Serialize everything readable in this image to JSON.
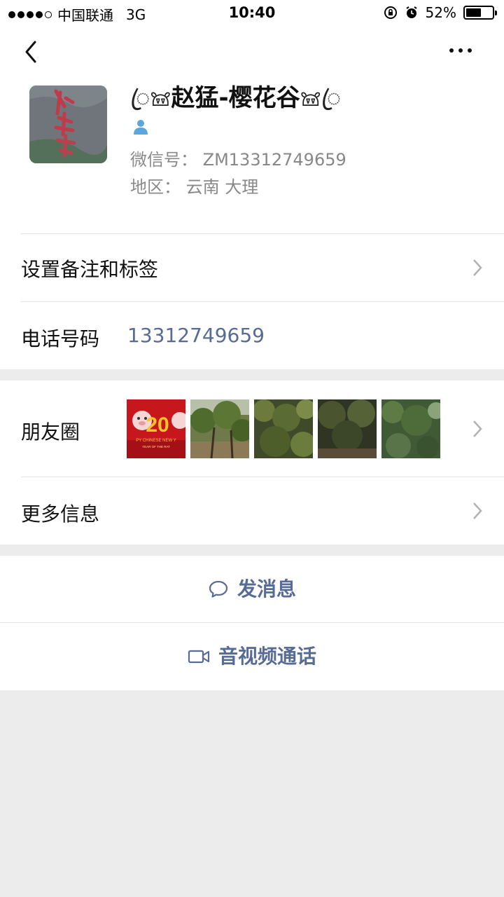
{
  "status_bar": {
    "carrier": "中国联通",
    "network": "3G",
    "time": "10:40",
    "battery": "52%"
  },
  "profile": {
    "nickname_deco_left": "ꦿ𖠌",
    "nickname": "赵猛-樱花谷",
    "nickname_deco_right": "𖠌ꦿ",
    "wechat_id_label": "微信号：",
    "wechat_id": "ZM13312749659",
    "region_label": "地区：",
    "region": "云南 大理"
  },
  "rows": {
    "remark": "设置备注和标签",
    "phone_label": "电话号码",
    "phone_value": "13312749659",
    "moments": "朋友圈",
    "more_info": "更多信息"
  },
  "moments_banner": {
    "top_text": "20",
    "mid_text": "PY CHINESE NEW Y",
    "bottom_text": "YEAR OF THE RAT"
  },
  "actions": {
    "message": "发消息",
    "call": "音视频通话"
  },
  "colors": {
    "link": "#576b95",
    "background": "#ececec",
    "divider": "#e5e5e5"
  }
}
